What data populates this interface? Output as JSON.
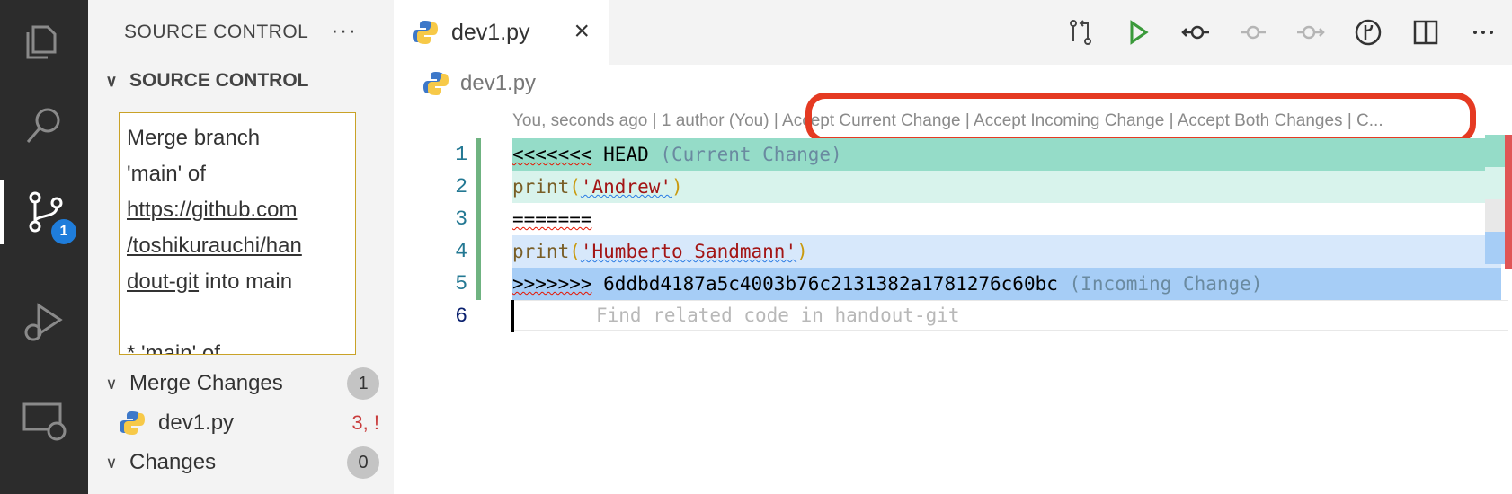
{
  "activity_bar": {
    "items": [
      "explorer",
      "search",
      "source-control",
      "run-and-debug",
      "remote-explorer"
    ],
    "scm_badge": "1"
  },
  "sidebar": {
    "title": "SOURCE CONTROL",
    "section": "SOURCE CONTROL",
    "commit_message": {
      "line1": "Merge branch",
      "line2": "'main' of",
      "link1": "https://github.com",
      "link2": "/toshikurauchi/han",
      "link3": "dout-git",
      "after_link": " into main",
      "cut_line": "* 'main' of"
    },
    "merge_changes": {
      "label": "Merge Changes",
      "count": "1"
    },
    "file": {
      "name": "dev1.py",
      "status": "3, !"
    },
    "changes": {
      "label": "Changes",
      "count": "0"
    }
  },
  "editor": {
    "tab_label": "dev1.py",
    "breadcrumb": "dev1.py",
    "codelens": {
      "blame": "You, seconds ago | 1 author (You)",
      "actions": " | Accept Current Change | Accept Incoming Change | Accept Both Changes | C..."
    },
    "lines": {
      "l1": {
        "num": "1",
        "marker": "<<<<<<<",
        "head": " HEAD ",
        "note": "(Current Change)"
      },
      "l2": {
        "num": "2",
        "fn": "print",
        "open": "(",
        "str": "'Andrew'",
        "close": ")"
      },
      "l3": {
        "num": "3",
        "text": "======="
      },
      "l4": {
        "num": "4",
        "fn": "print",
        "open": "(",
        "str": "'Humberto Sandmann'",
        "close": ")"
      },
      "l5": {
        "num": "5",
        "marker": ">>>>>>>",
        "hash": " 6ddbd4187a5c4003b76c2131382a1781276c60bc ",
        "note": "(Incoming Change)"
      },
      "l6": {
        "num": "6",
        "placeholder": "Find related code in handout-git"
      }
    }
  },
  "colors": {
    "accent_badge": "#1f7ddb",
    "current_head": "#95dcc8",
    "incoming_head": "#a6cdf6",
    "highlight": "#e53a22"
  }
}
